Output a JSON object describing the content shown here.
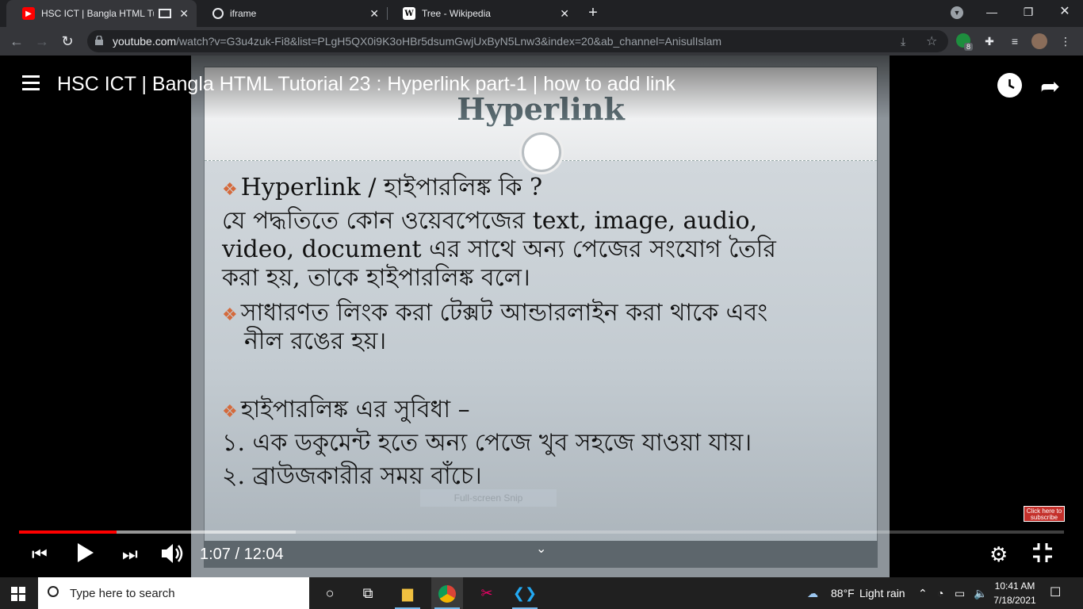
{
  "browser": {
    "tabs": [
      {
        "title": "HSC ICT | Bangla HTML Tutorial 23 : Hyperlink part-1 | how to add link",
        "favicon": "youtube-icon",
        "active": true
      },
      {
        "title": "iframe",
        "favicon": "globe-icon",
        "active": false
      },
      {
        "title": "Tree - Wikipedia",
        "favicon": "wikipedia-icon",
        "active": false
      }
    ],
    "url_host": "youtube.com",
    "url_rest": "/watch?v=G3u4zuk-Fi8&list=PLgH5QX0i9K3oHBr5dsumGwjUxByN5Lnw3&index=20&ab_channel=AnisulIslam",
    "extension_badge": "8"
  },
  "video": {
    "title": "HSC ICT | Bangla HTML Tutorial 23 : Hyperlink part-1 | how to add link",
    "time_current": "1:07",
    "time_total": "12:04",
    "time_display": "1:07 / 12:04",
    "played_fraction": 0.093,
    "loaded_fraction": 0.265,
    "subscribe_label": "Click here to subscribe"
  },
  "slide": {
    "heading": "Hyperlink",
    "line1": "Hyperlink / হাইপারলিঙ্ক কি ?",
    "para1a": "যে পদ্ধতিতে কোন ওয়েবপেজের text, image, audio,",
    "para1b": "video, document এর সাথে অন্য পেজের সংযোগ তৈরি",
    "para1c": "করা হয়, তাকে হাইপারলিঙ্ক বলে।",
    "line2a": "সাধারণত লিংক করা টেক্সট আন্ডারলাইন করা থাকে এবং",
    "line2b": "নীল রঙের হয়।",
    "line3": "হাইপারলিঙ্ক  এর সুবিধা –",
    "item1": "১. এক ডকুমেন্ট হতে অন্য পেজে খুব সহজে যাওয়া যায়।",
    "item2": "২. ব্রাউজকারীর সময় বাঁচে।",
    "snip_label": "Full-screen Snip"
  },
  "taskbar": {
    "search_placeholder": "Type here to search",
    "weather_temp": "88°F",
    "weather_desc": "Light rain",
    "time": "10:41 AM",
    "date": "7/18/2021"
  },
  "colors": {
    "youtube_red": "#ff0000",
    "chrome_dark": "#202124",
    "chrome_toolbar": "#35363a"
  }
}
